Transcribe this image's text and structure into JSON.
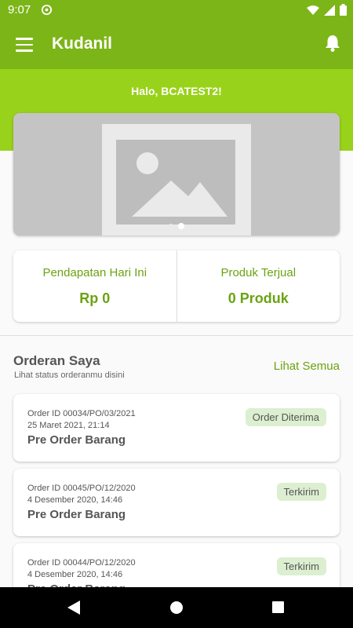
{
  "status_bar": {
    "time": "9:07"
  },
  "app_bar": {
    "title": "Kudanil"
  },
  "greeting": "Halo, BCATEST2!",
  "banner": {
    "slide_count": 2,
    "active_slide": 2
  },
  "stats": {
    "income_label": "Pendapatan Hari Ini",
    "income_value": "Rp 0",
    "sold_label": "Produk Terjual",
    "sold_value": "0 Produk"
  },
  "orders": {
    "title": "Orderan Saya",
    "subtitle": "Lihat status orderanmu disini",
    "see_all": "Lihat Semua",
    "items": [
      {
        "id": "Order ID 00034/PO/03/2021",
        "date": "25 Maret 2021, 21:14",
        "type": "Pre Order Barang",
        "status": "Order Diterima"
      },
      {
        "id": "Order ID 00045/PO/12/2020",
        "date": "4 Desember 2020, 14:46",
        "type": "Pre Order Barang",
        "status": "Terkirim"
      },
      {
        "id": "Order ID 00044/PO/12/2020",
        "date": "4 Desember 2020, 14:46",
        "type": "Pre Order Barang",
        "status": "Terkirim"
      }
    ]
  },
  "colors": {
    "primary": "#7cb518",
    "hero": "#99d21a",
    "accent_text": "#6aa312",
    "badge_bg": "#dcefd0"
  },
  "icons": {
    "menu": "menu-icon",
    "notification": "bell-icon",
    "placeholder": "image-placeholder-icon"
  }
}
